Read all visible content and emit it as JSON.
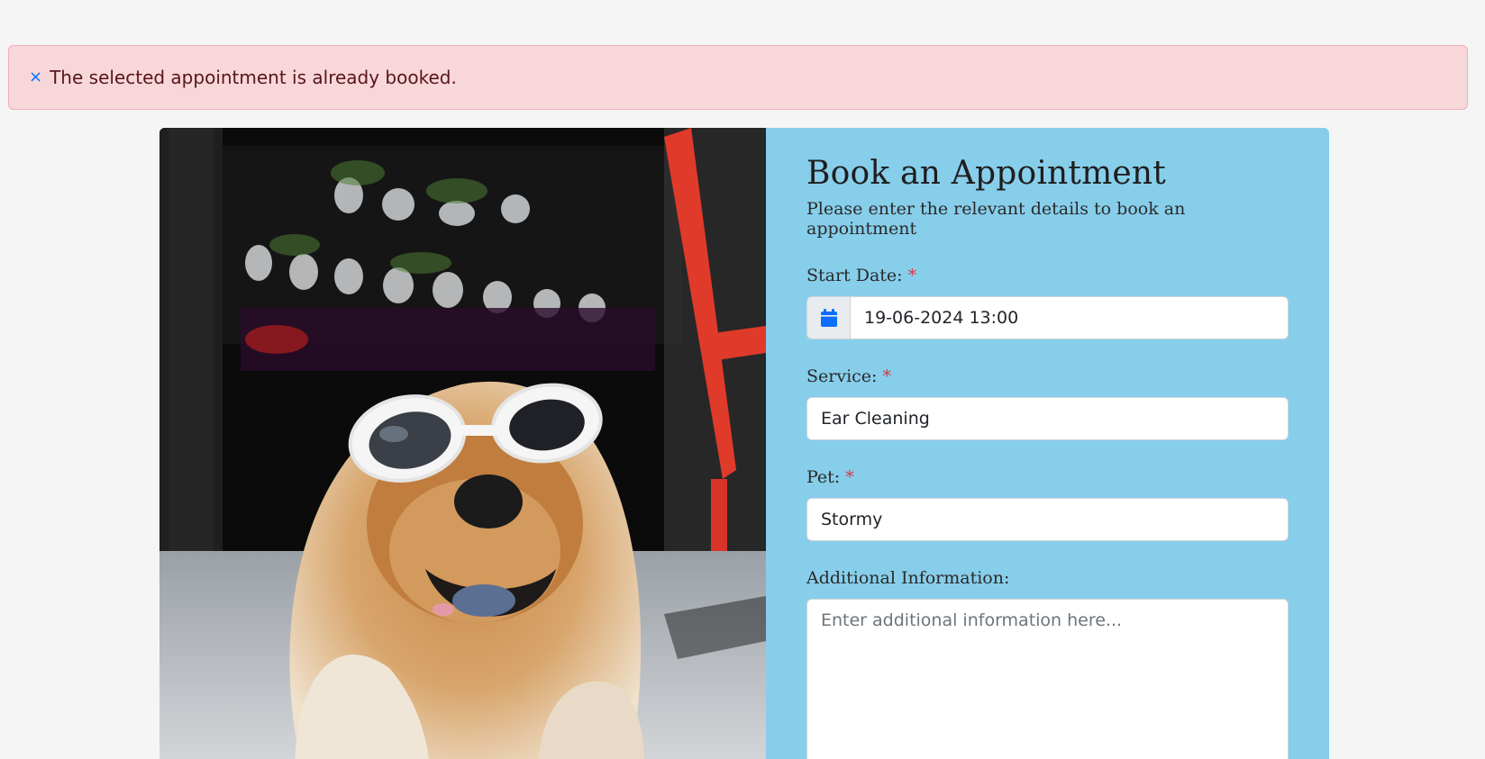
{
  "alert": {
    "close_symbol": "×",
    "message": "The selected appointment is already booked."
  },
  "form": {
    "title": "Book an Appointment",
    "subtitle": "Please enter the relevant details to book an appointment",
    "required_marker": "*",
    "start_date": {
      "label": "Start Date:",
      "value": "19-06-2024 13:00",
      "icon": "calendar-icon"
    },
    "service": {
      "label": "Service:",
      "value": "Ear Cleaning"
    },
    "pet": {
      "label": "Pet:",
      "value": "Stormy"
    },
    "additional": {
      "label": "Additional Information:",
      "placeholder": "Enter additional information here..."
    }
  },
  "colors": {
    "form_background": "#87ceeb",
    "alert_background": "#f8d7da",
    "required": "#dc3545",
    "calendar_icon": "#0d6efd"
  }
}
